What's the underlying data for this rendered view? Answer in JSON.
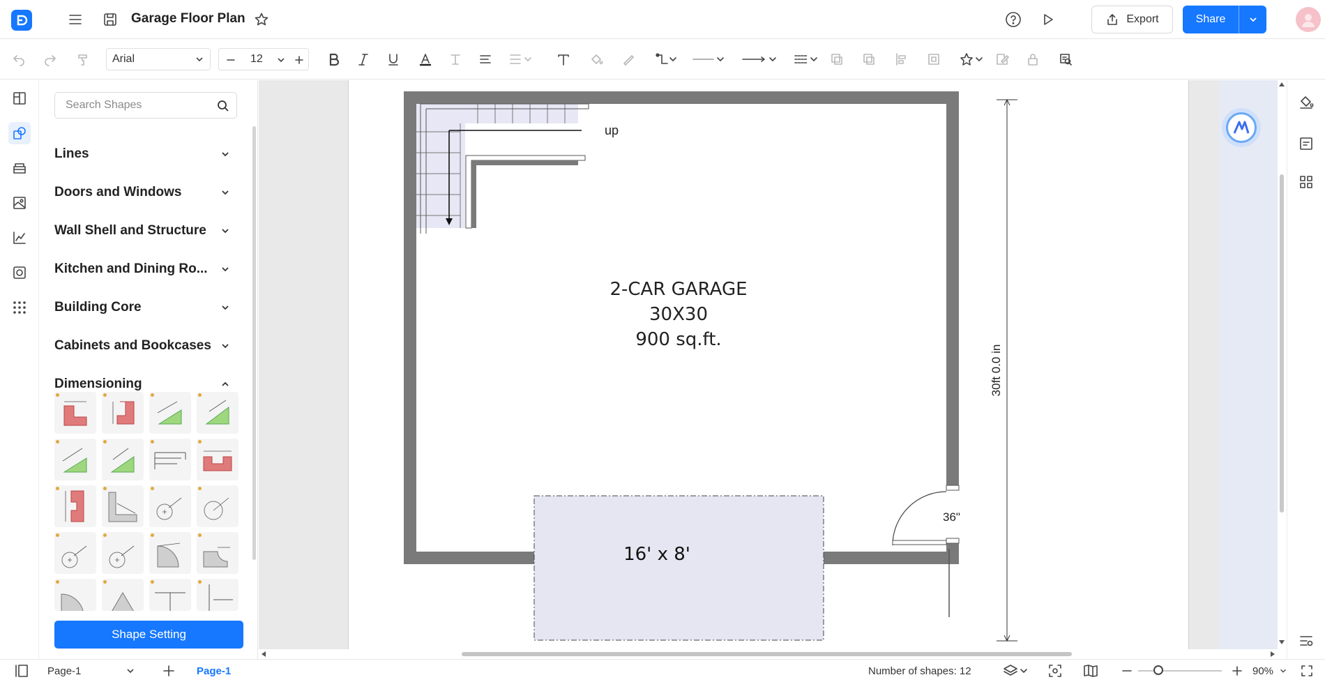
{
  "header": {
    "title": "Garage Floor Plan",
    "export_label": "Export",
    "share_label": "Share"
  },
  "toolbar": {
    "font": "Arial",
    "font_size": "12"
  },
  "library": {
    "search_placeholder": "Search Shapes",
    "categories": [
      {
        "label": "Lines",
        "expanded": false
      },
      {
        "label": "Doors and Windows",
        "expanded": false
      },
      {
        "label": "Wall Shell and Structure",
        "expanded": false
      },
      {
        "label": "Kitchen and Dining Ro...",
        "expanded": false
      },
      {
        "label": "Building Core",
        "expanded": false
      },
      {
        "label": "Cabinets and Bookcases",
        "expanded": false
      },
      {
        "label": "Dimensioning",
        "expanded": true
      }
    ],
    "shape_setting_label": "Shape Setting"
  },
  "canvas": {
    "stair_label": "up",
    "room_name": "2-CAR GARAGE",
    "room_dims": "30X30",
    "room_area": "900 sq.ft.",
    "door_label": "36\"",
    "garage_door_label": "16' x 8'",
    "dimension_label": "30ft 0.0 in"
  },
  "statusbar": {
    "page_select": "Page-1",
    "active_page": "Page-1",
    "shape_count": "Number of shapes: 12",
    "zoom": "90%"
  },
  "colors": {
    "accent": "#1677ff",
    "wall": "#7a7a7a",
    "garage_door_fill": "#e6e6f2"
  }
}
